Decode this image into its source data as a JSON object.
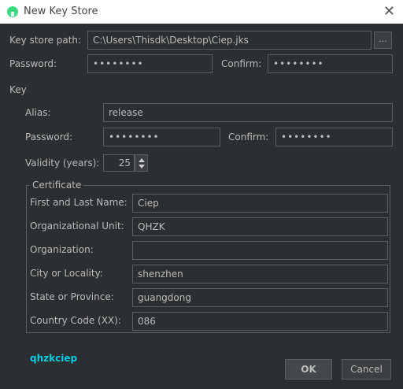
{
  "window": {
    "title": "New Key Store"
  },
  "keystore": {
    "path_label": "Key store path:",
    "path_value": "C:\\Users\\Thisdk\\Desktop\\Ciep.jks",
    "browse_label": "...",
    "password_label": "Password:",
    "password_mask": "••••••••",
    "confirm_label": "Confirm:",
    "confirm_mask": "••••••••"
  },
  "key": {
    "section_label": "Key",
    "alias_label": "Alias:",
    "alias_value": "release",
    "password_label": "Password:",
    "password_mask": "••••••••",
    "confirm_label": "Confirm:",
    "confirm_mask": "••••••••",
    "validity_label": "Validity (years):",
    "validity_value": "25"
  },
  "certificate": {
    "title": "Certificate",
    "fields": [
      {
        "label": "First and Last Name:",
        "value": "Ciep"
      },
      {
        "label": "Organizational Unit:",
        "value": "QHZK"
      },
      {
        "label": "Organization:",
        "value": ""
      },
      {
        "label": "City or Locality:",
        "value": "shenzhen"
      },
      {
        "label": "State or Province:",
        "value": "guangdong"
      },
      {
        "label": "Country Code (XX):",
        "value": "086"
      }
    ]
  },
  "watermark": "qhzkciep",
  "buttons": {
    "ok": "OK",
    "cancel": "Cancel"
  },
  "colors": {
    "background": "#2b2f31",
    "border": "#5c5f61",
    "text": "#bbbbbb",
    "watermark": "#00cfe0"
  }
}
